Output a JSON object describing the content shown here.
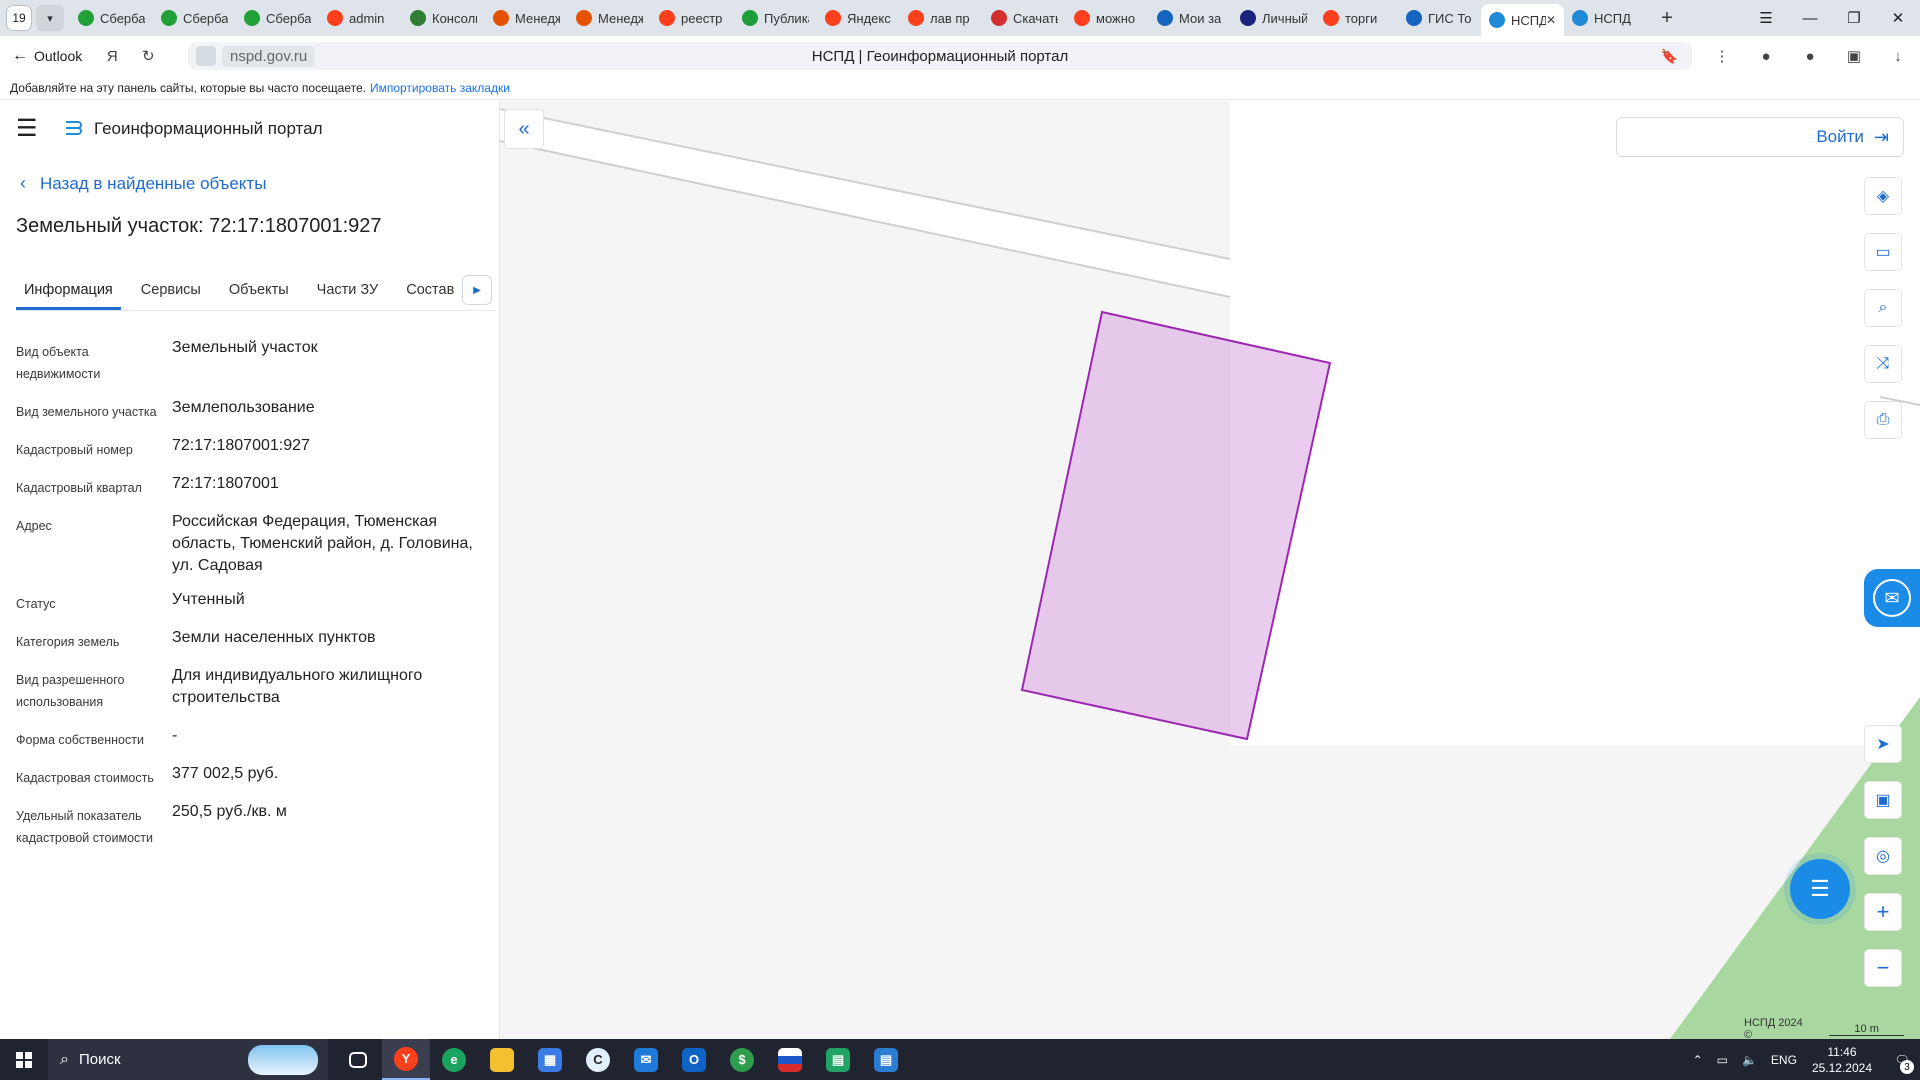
{
  "browser": {
    "tab_count": "19",
    "tabs": [
      {
        "label": "Сбербанк",
        "color": "#21a038"
      },
      {
        "label": "Сбербанк",
        "color": "#21a038"
      },
      {
        "label": "Сбербанк",
        "color": "#21a038"
      },
      {
        "label": "admin",
        "color": "#fc3f1d"
      },
      {
        "label": "Консоль",
        "color": "#2e7d32"
      },
      {
        "label": "Менеджер",
        "color": "#e65100"
      },
      {
        "label": "Менеджер",
        "color": "#e65100"
      },
      {
        "label": "реестр",
        "color": "#fc3f1d"
      },
      {
        "label": "Публикация",
        "color": "#1e9e3a"
      },
      {
        "label": "Яндекс",
        "color": "#fc3f1d"
      },
      {
        "label": "лав пр",
        "color": "#fc3f1d"
      },
      {
        "label": "Скачать",
        "color": "#d32f2f"
      },
      {
        "label": "можно",
        "color": "#fc3f1d"
      },
      {
        "label": "Мои за",
        "color": "#1565c0"
      },
      {
        "label": "Личный",
        "color": "#1a237e"
      },
      {
        "label": "торги",
        "color": "#fc3f1d"
      },
      {
        "label": "ГИС То",
        "color": "#1565c0"
      },
      {
        "label": "НСПД",
        "color": "#1f8ad6"
      },
      {
        "label": "НСПД",
        "color": "#1f8ad6"
      }
    ],
    "back_label": "Outlook",
    "url": "nspd.gov.ru",
    "page_title": "НСПД | Геоинформационный портал",
    "bookmarks_hint": "Добавляйте на эту панель сайты, которые вы часто посещаете.",
    "bookmarks_import": "Импортировать закладки"
  },
  "sidebar": {
    "brand": "Геоинформационный портал",
    "back_link": "Назад в найденные объекты",
    "title": "Земельный участок: 72:17:1807001:927",
    "tabs": [
      "Информация",
      "Сервисы",
      "Объекты",
      "Части ЗУ",
      "Состав"
    ],
    "properties": [
      {
        "label": "Вид объекта недвижимости",
        "value": "Земельный участок"
      },
      {
        "label": "Вид земельного участка",
        "value": "Землепользование"
      },
      {
        "label": "Кадастровый номер",
        "value": "72:17:1807001:927"
      },
      {
        "label": "Кадастровый квартал",
        "value": "72:17:1807001"
      },
      {
        "label": "Адрес",
        "value": "Российская Федерация, Тюменская область, Тюменский район, д. Головина, ул. Садовая"
      },
      {
        "label": "Статус",
        "value": "Учтенный"
      },
      {
        "label": "Категория земель",
        "value": "Земли населенных пунктов"
      },
      {
        "label": "Вид разрешенного использования",
        "value": "Для индивидуального жилищного строительства"
      },
      {
        "label": "Форма собственности",
        "value": "-"
      },
      {
        "label": "Кадастровая стоимость",
        "value": "377 002,5 руб."
      },
      {
        "label": "Удельный показатель кадастровой стоимости",
        "value": "250,5 руб./кв. м"
      }
    ]
  },
  "map": {
    "login_label": "Войти",
    "copyright": "НСПД 2024 ©",
    "scale": "10 m",
    "parcel_color": "#9c27b0"
  },
  "taskbar": {
    "search_placeholder": "Поиск",
    "lang": "ENG",
    "time": "11:46",
    "date": "25.12.2024",
    "notifications": "3"
  }
}
